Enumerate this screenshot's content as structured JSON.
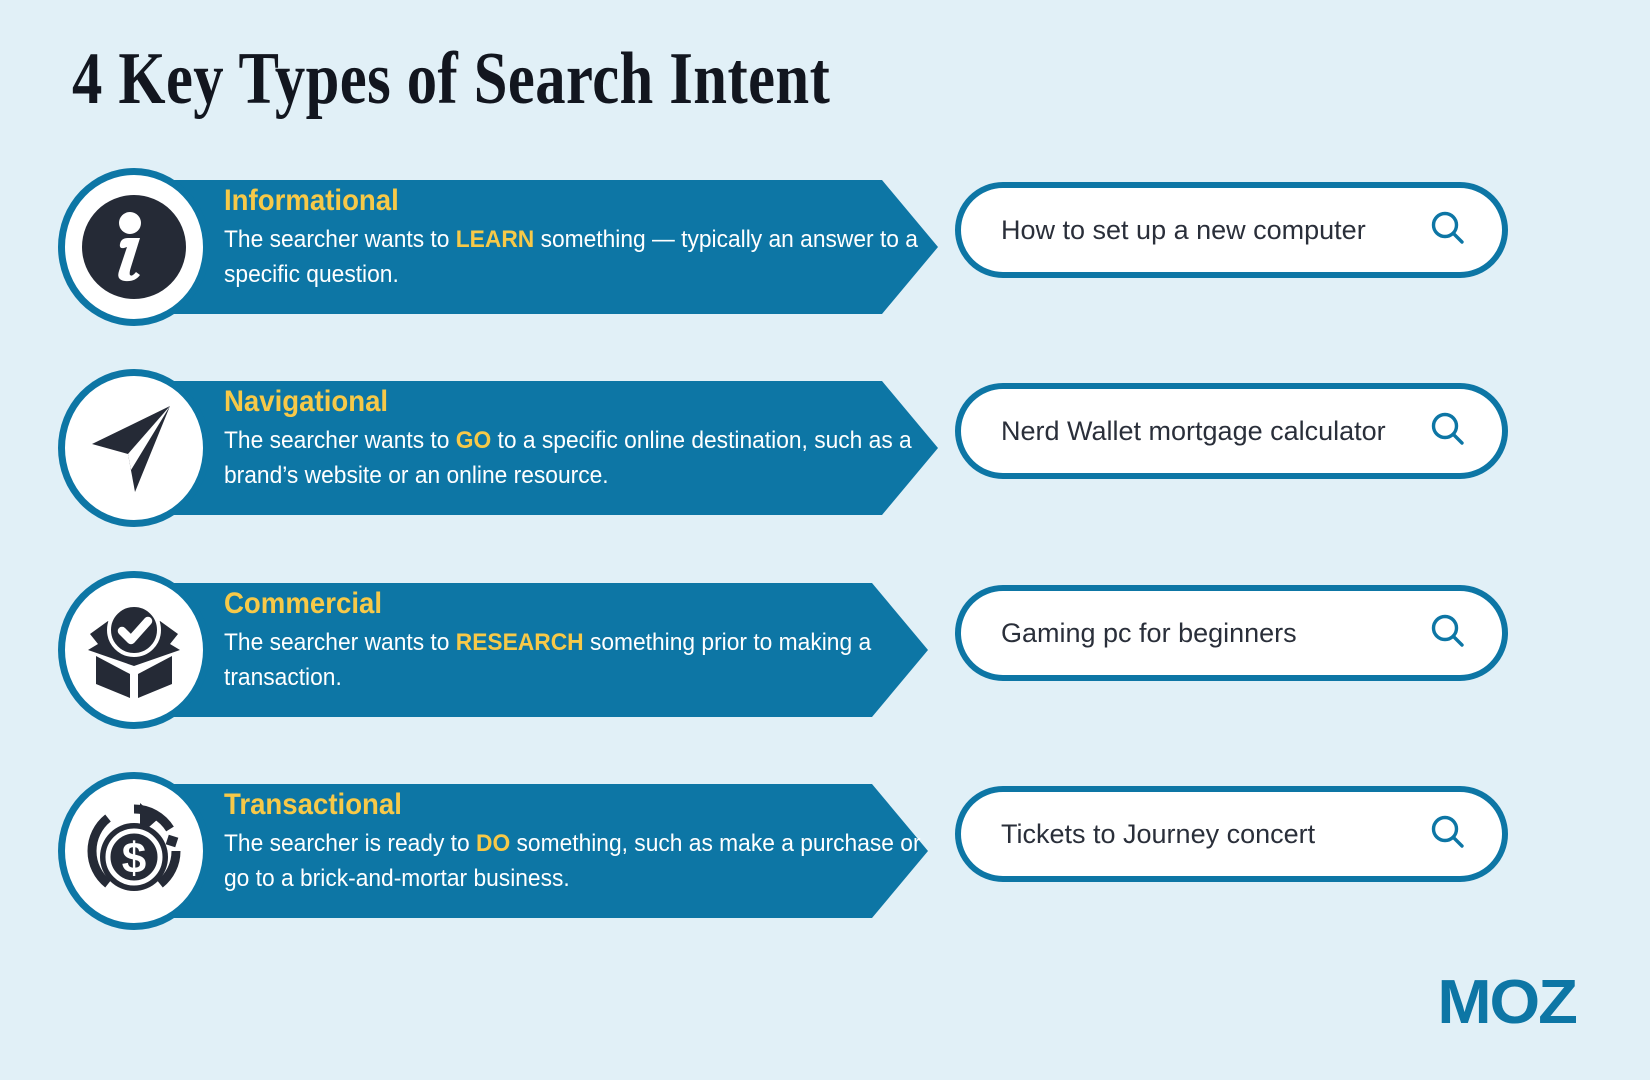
{
  "page": {
    "title": "4 Key Types of Search Intent",
    "background_color": "#e1f0f7",
    "brand_color": "#0d76a5",
    "accent_color": "#f7c948",
    "dark_color": "#252a36",
    "logo": "MOZ"
  },
  "rows": [
    {
      "icon": "info-icon",
      "heading": "Informational",
      "desc_pre": "The searcher wants to ",
      "desc_keyword": "LEARN",
      "desc_post": " something — typically an answer to a specific question.",
      "search_query": "How to set up a new computer",
      "search_icon": "magnifier-icon"
    },
    {
      "icon": "navigation-arrow-icon",
      "heading": "Navigational",
      "desc_pre": "The searcher wants to ",
      "desc_keyword": "GO",
      "desc_post": " to a specific online destination, such as a brand’s website or an online resource.",
      "search_query": "Nerd Wallet mortgage calculator",
      "search_icon": "magnifier-icon"
    },
    {
      "icon": "box-check-icon",
      "heading": "Commercial",
      "desc_pre": "The searcher wants to ",
      "desc_keyword": "RESEARCH",
      "desc_post": " something prior to making a transaction.",
      "search_query": "Gaming pc for beginners",
      "search_icon": "magnifier-icon"
    },
    {
      "icon": "dollar-refresh-icon",
      "heading": "Transactional",
      "desc_pre": "The searcher is ready to ",
      "desc_keyword": "DO",
      "desc_post": " something, such as make a purchase or go to a brick-and-mortar business.",
      "search_query": "Tickets to Journey concert",
      "search_icon": "magnifier-icon"
    }
  ]
}
